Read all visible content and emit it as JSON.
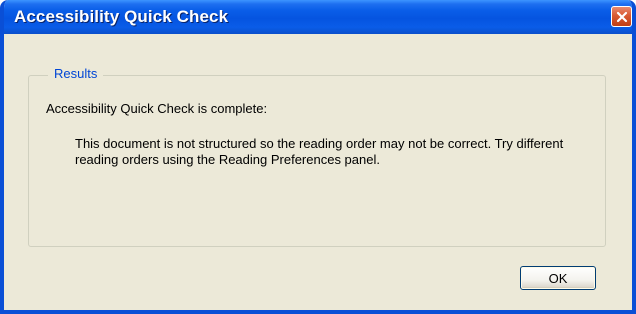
{
  "window": {
    "title": "Accessibility Quick Check",
    "titlebar_color": "#0554e0",
    "close_icon": "close-icon"
  },
  "results": {
    "group_label": "Results",
    "status_text": "Accessibility Quick Check is complete:",
    "message": "This document is not structured so the reading order may not be correct. Try different reading orders using the Reading Preferences panel."
  },
  "buttons": {
    "ok_label": "OK"
  }
}
